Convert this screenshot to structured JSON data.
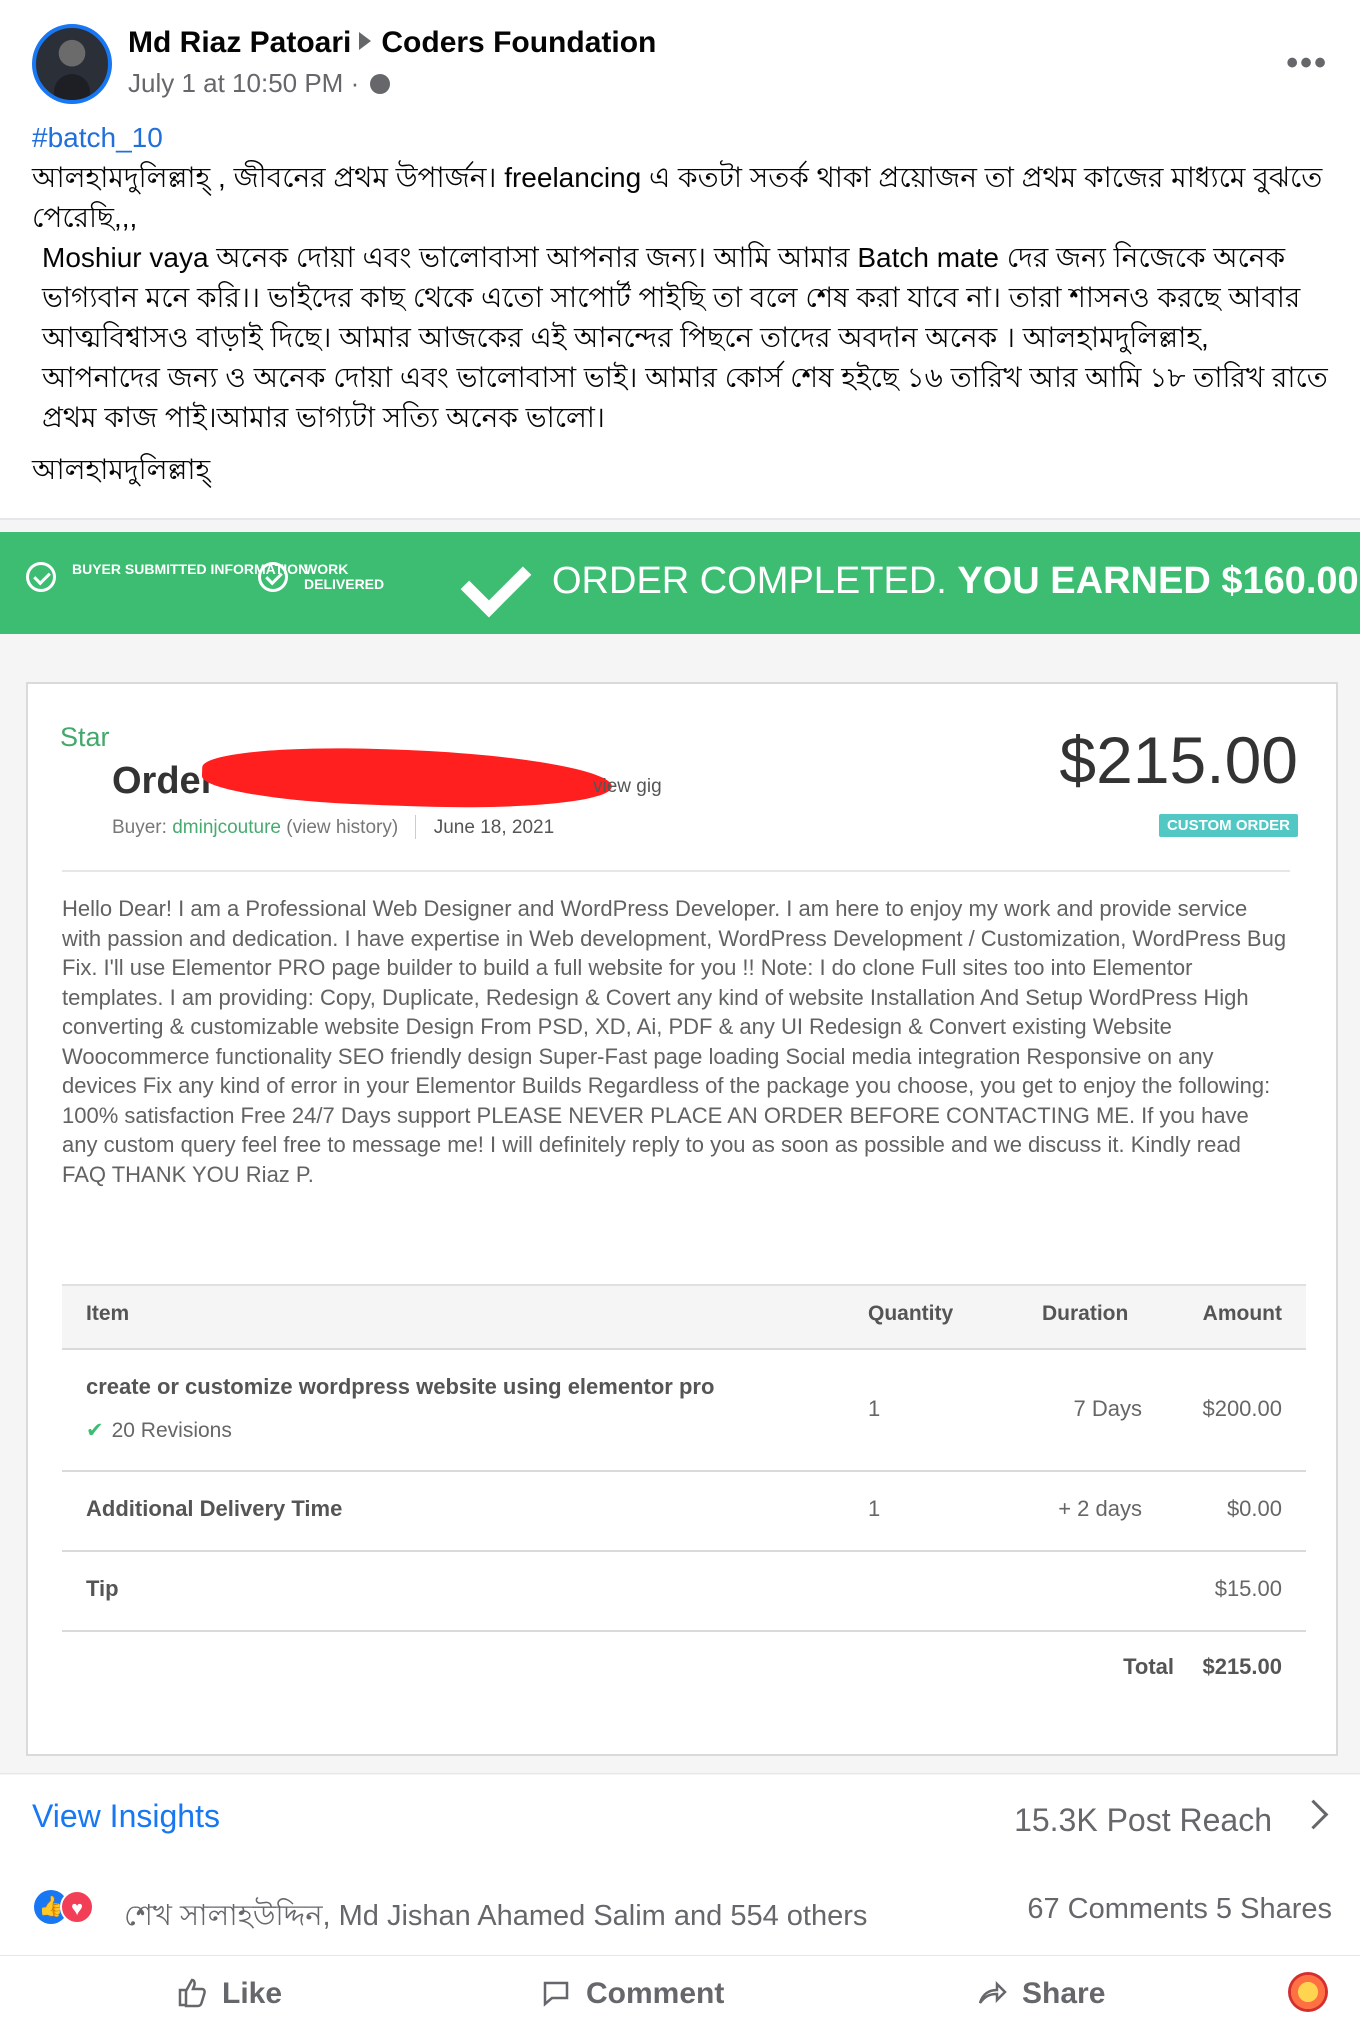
{
  "post": {
    "author": "Md Riaz Patoari",
    "group": "Coders Foundation",
    "timestamp": "July 1 at 10:50 PM",
    "meta_separator": "·",
    "more_icon": "more-options-icon",
    "text": {
      "hashtag": "#batch_10",
      "line_1": "আলহামদুলিল্লাহ্ , জীবনের প্রথম উপার্জন। freelancing এ কতটা সতর্ক থাকা প্রয়োজন তা প্রথম কাজের মাধ্যমে বুঝতে পেরেছি,,,",
      "line_2": "Moshiur vaya  অনেক দোয়া এবং ভালোবাসা আপনার জন্য। আমি আমার Batch mate দের জন্য  নিজেকে অনেক ভাগ্যবান মনে করি।। ভাইদের কাছ থেকে এতো সাপোর্ট পাইছি তা বলে শেষ করা যাবে না। তারা শাসনও করছে আবার আত্মবিশ্বাসও বাড়াই দিছে। আমার আজকের এই আনন্দের পিছনে তাদের অবদান অনেক । আলহামদুলিল্লাহ, আপনাদের জন্য ও অনেক দোয়া এবং ভালোবাসা ভাই। আমার কোর্স শেষ হইছে ১৬ তারিখ আর আমি ১৮ তারিখ রাতে প্রথম কাজ পাই।আমার ভাগ্যটা সত্যি অনেক ভালো।",
      "line_3": "আলহামদুলিল্লাহ্"
    }
  },
  "order_screenshot": {
    "banner": {
      "step_1": "BUYER SUBMITTED INFORMATION",
      "step_2": "WORK DELIVERED",
      "status": "ORDER COMPLETED.",
      "earned": "YOU EARNED $160.00",
      "color": "#3cbd72"
    },
    "card": {
      "star_label": "Star",
      "order_label": "Order",
      "view_gig": "view gig",
      "buyer_prefix": "Buyer:",
      "buyer_name": "dminjcouture",
      "history": "(view history)",
      "date": "June 18, 2021",
      "price": "$215.00",
      "badge": "CUSTOM ORDER",
      "description": "Hello Dear! I am a Professional Web Designer and WordPress Developer. I am here to enjoy my work and provide service with passion and dedication. I have expertise in Web development, WordPress Development / Customization, WordPress Bug Fix. I'll use Elementor PRO page builder to build a full website for you !! Note: I do clone Full sites too into Elementor templates. I am providing: Copy, Duplicate, Redesign & Covert any kind of website Installation And Setup WordPress High converting & customizable website Design From PSD, XD, Ai, PDF & any UI Redesign & Convert existing Website Woocommerce functionality SEO friendly design Super-Fast page loading Social media integration Responsive on any devices Fix any kind of error in your Elementor Builds Regardless of the package you choose, you get to enjoy the following: 100% satisfaction Free 24/7 Days support PLEASE NEVER PLACE AN ORDER BEFORE CONTACTING ME. If you have any custom query feel free to message me! I will definitely reply to you as soon as possible and we discuss it. Kindly read FAQ THANK YOU Riaz P.",
      "table": {
        "headers": [
          "Item",
          "Quantity",
          "Duration",
          "Amount"
        ],
        "main_item": "create or customize wordpress website using elementor pro",
        "main_revision": "20 Revisions",
        "main_qty": "1",
        "main_duration": "7 Days",
        "main_amount": "$200.00",
        "add_item": "Additional Delivery Time",
        "add_qty": "1",
        "add_duration": "+ 2 days",
        "add_amount": "$0.00",
        "tip_item": "Tip",
        "tip_amount": "$15.00",
        "total_label": "Total",
        "total_amount": "$215.00"
      }
    }
  },
  "footer": {
    "view_insights": "View Insights",
    "post_reach": "15.3K Post Reach",
    "reaction_names": "শেখ সালাহউদ্দিন, Md Jishan Ahamed Salim and 554 others",
    "comments": "67 Comments",
    "shares": "5 Shares",
    "actions": {
      "like": "Like",
      "comment": "Comment",
      "share": "Share"
    }
  },
  "colors": {
    "facebook_blue": "#1877f2",
    "fiverr_green": "#3cbd72",
    "redaction_red": "#ff1f1f"
  }
}
